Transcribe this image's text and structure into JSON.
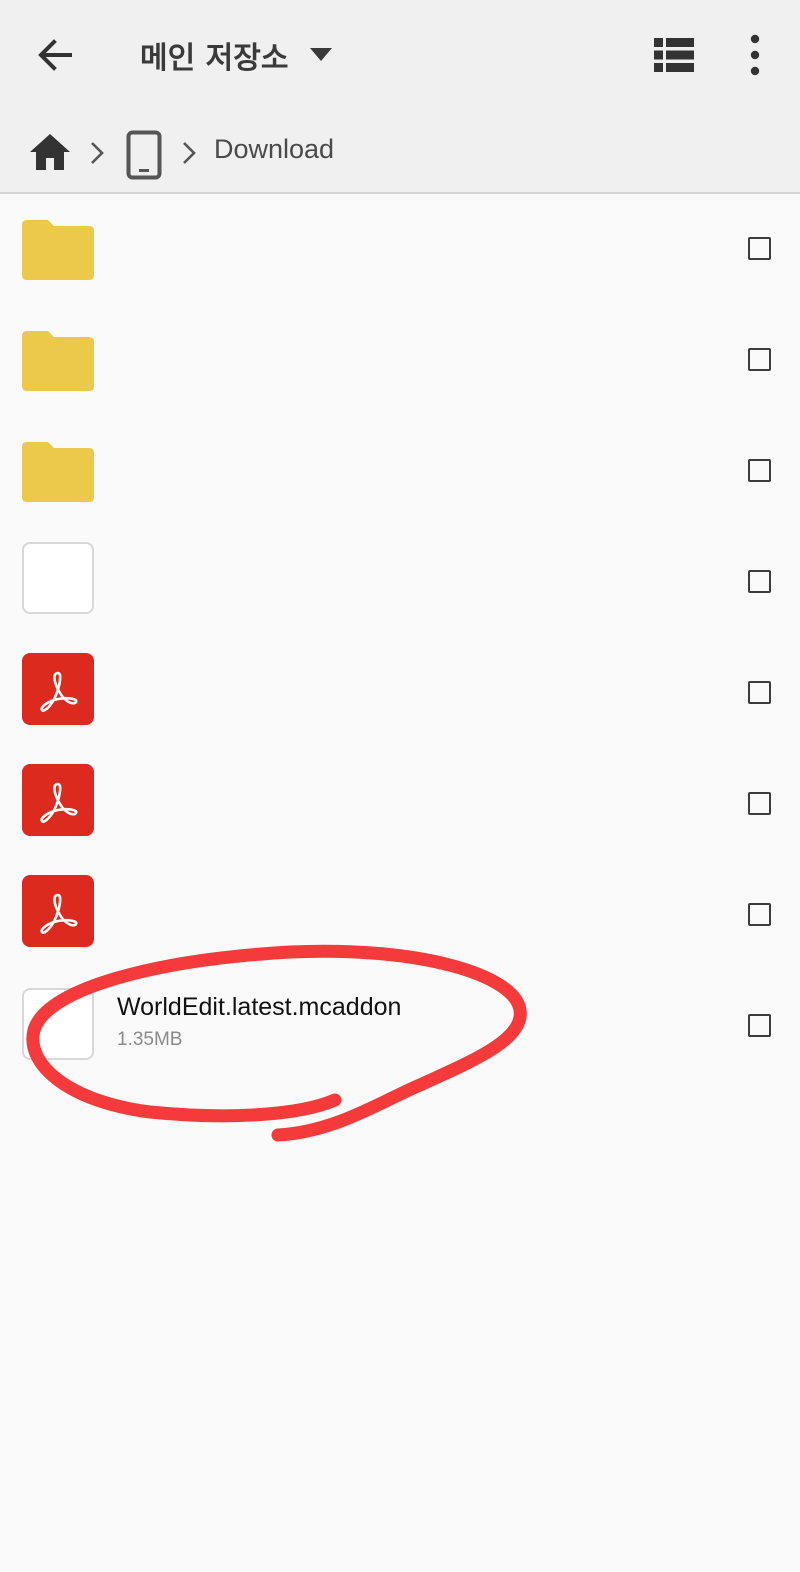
{
  "header": {
    "title": "메인 저장소",
    "icons": {
      "back": "arrow-left-icon",
      "dropdown": "caret-down-icon",
      "view": "list-view-icon",
      "more": "more-vertical-icon"
    }
  },
  "breadcrumb": {
    "current": "Download",
    "icons": [
      "home-icon",
      "device-icon"
    ]
  },
  "files": [
    {
      "kind": "folder"
    },
    {
      "kind": "folder"
    },
    {
      "kind": "folder"
    },
    {
      "kind": "file"
    },
    {
      "kind": "pdf"
    },
    {
      "kind": "pdf"
    },
    {
      "kind": "pdf"
    },
    {
      "kind": "file",
      "name": "WorldEdit.latest.mcaddon",
      "size": "1.35MB"
    }
  ],
  "colors": {
    "header_bg": "#f0f0f0",
    "folder": "#ecc94b",
    "pdf": "#dd2a1f",
    "annotation": "#f43a3a"
  }
}
